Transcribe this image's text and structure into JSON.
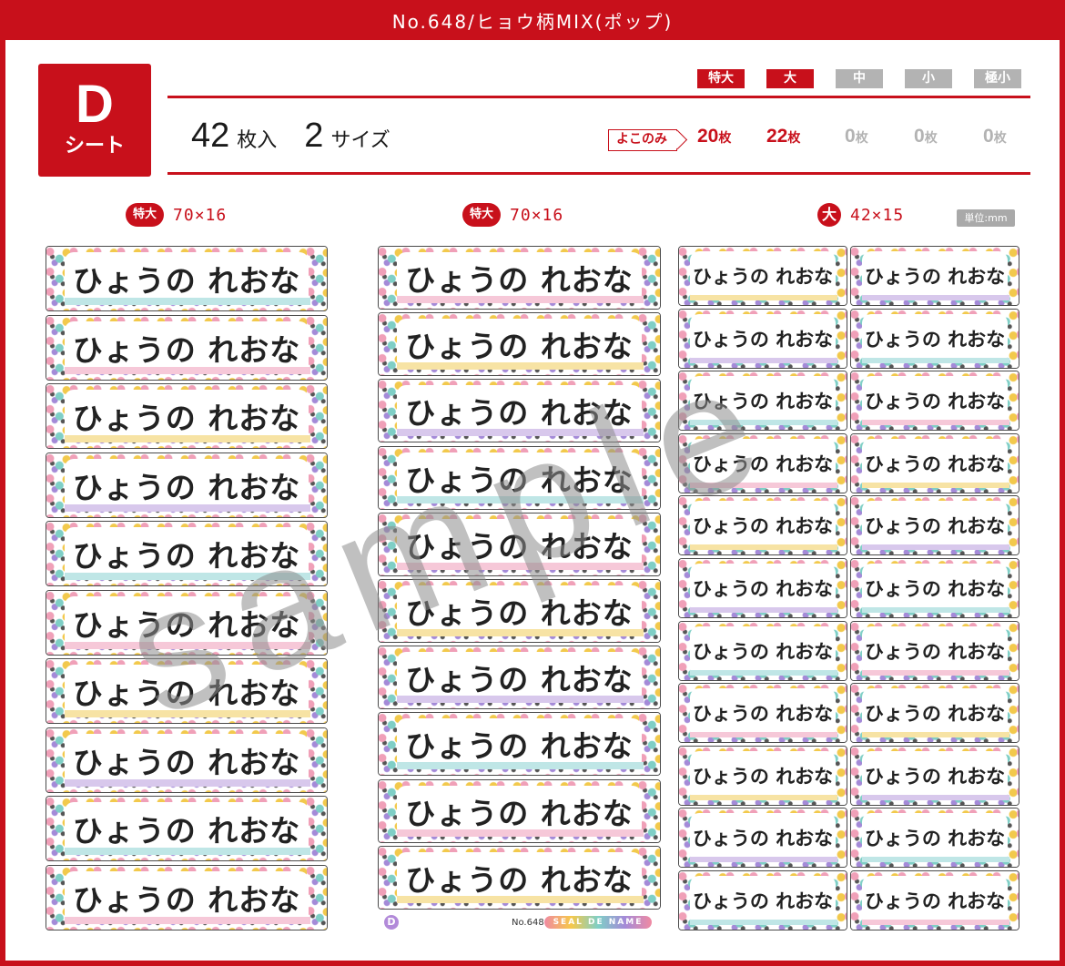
{
  "title": "No.648/ヒョウ柄MIX(ポップ)",
  "sheet": {
    "letter": "D",
    "label": "シート"
  },
  "summary": {
    "count": "42",
    "count_unit": "枚入",
    "sizes": "2",
    "sizes_unit": "サイズ"
  },
  "size_tags": [
    {
      "label": "特大",
      "active": true
    },
    {
      "label": "大",
      "active": true
    },
    {
      "label": "中",
      "active": false
    },
    {
      "label": "小",
      "active": false
    },
    {
      "label": "極小",
      "active": false
    }
  ],
  "yoko_label": "よこのみ",
  "counts": [
    {
      "value": "20",
      "unit": "枚",
      "active": true
    },
    {
      "value": "22",
      "unit": "枚",
      "active": true
    },
    {
      "value": "0",
      "unit": "枚",
      "active": false
    },
    {
      "value": "0",
      "unit": "枚",
      "active": false
    },
    {
      "value": "0",
      "unit": "枚",
      "active": false
    }
  ],
  "columns": [
    {
      "size_label": "特大",
      "dims": "70×16"
    },
    {
      "size_label": "特大",
      "dims": "70×16"
    },
    {
      "size_label": "大",
      "dims": "42×15"
    }
  ],
  "unit_note": "単位:mm",
  "label_text": "ひょうの れおな",
  "footer": {
    "sheet_letter": "D",
    "product_no": "No.648",
    "brand": "SEAL DE NAME"
  },
  "watermark": "sample",
  "colors": {
    "accent": "#c8101b",
    "inactive": "#b3b3b3"
  }
}
